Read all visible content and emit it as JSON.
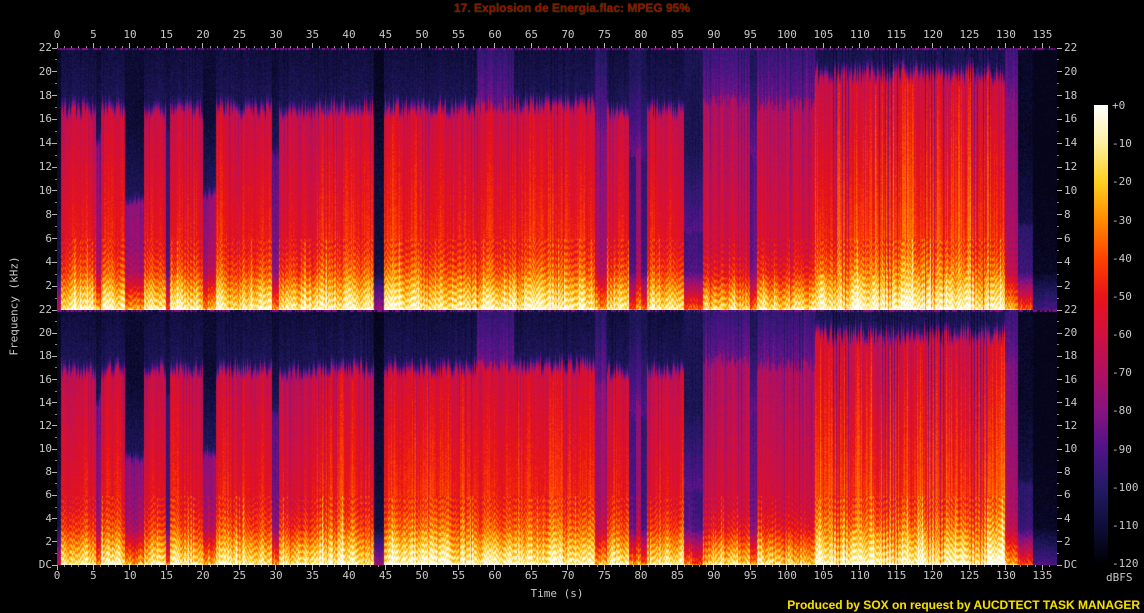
{
  "header": {
    "title": "17. Explosion de Energia.flac: MPEG 95%"
  },
  "footer": {
    "credit": "Produced by SOX on request by AUCDTECT TASK MANAGER"
  },
  "axes": {
    "time_label": "Time (s)",
    "freq_label": "Frequency (kHz)",
    "time_ticks": [
      "0",
      "5",
      "10",
      "15",
      "20",
      "25",
      "30",
      "35",
      "40",
      "45",
      "50",
      "55",
      "60",
      "65",
      "70",
      "75",
      "80",
      "85",
      "90",
      "95",
      "100",
      "105",
      "110",
      "115",
      "120",
      "125",
      "130",
      "135"
    ],
    "freq_ticks": [
      "22",
      "20",
      "18",
      "16",
      "14",
      "12",
      "10",
      "8",
      "6",
      "4",
      "2"
    ],
    "dc_label": "DC",
    "label_color": "#c8c8c8",
    "tick_color": "#b4b4b4"
  },
  "colorbar": {
    "labels": [
      "+0",
      "-10",
      "-20",
      "-30",
      "-40",
      "-50",
      "-60",
      "-70",
      "-80",
      "-90",
      "-100",
      "-110",
      "-120"
    ],
    "unit": "dBFS"
  },
  "colors": {
    "background": "#000000",
    "title_text": "#8b1200",
    "footer_text": "#e6e600"
  },
  "chart_data": {
    "type": "heatmap",
    "subtype": "stereo-audio-spectrogram",
    "title": "17. Explosion de Energia.flac: MPEG 95%",
    "xlabel": "Time (s)",
    "ylabel": "Frequency (kHz)",
    "colorbar_label": "dBFS",
    "x_range_s": [
      0,
      137
    ],
    "x_tick_step_s": 5,
    "y_range_khz": [
      0,
      22
    ],
    "y_tick_step_khz": 2,
    "colorbar_db_range": [
      0,
      -120
    ],
    "colorbar_db_step": -10,
    "channels": [
      "left",
      "right"
    ],
    "grid": false,
    "legend_position": "right-colorbar",
    "palette_stops": [
      [
        0.0,
        "#000006"
      ],
      [
        0.083,
        "#0f0e3a"
      ],
      [
        0.167,
        "#251a66"
      ],
      [
        0.25,
        "#4f1388"
      ],
      [
        0.333,
        "#871380"
      ],
      [
        0.417,
        "#b01060"
      ],
      [
        0.5,
        "#d01040"
      ],
      [
        0.583,
        "#e81418"
      ],
      [
        0.667,
        "#ff4400"
      ],
      [
        0.75,
        "#ff8c00"
      ],
      [
        0.833,
        "#ffd020"
      ],
      [
        0.917,
        "#fff0a0"
      ],
      [
        1.0,
        "#ffffff"
      ]
    ],
    "beat_period_s": 0.42,
    "sections": [
      {
        "t0": 0.0,
        "t1": 0.5,
        "level": 0.15,
        "cutoff_khz": 8.0,
        "haze": 0,
        "stripe": 0.0
      },
      {
        "t0": 0.5,
        "t1": 5.3,
        "level": 0.78,
        "cutoff_khz": 16.5,
        "haze": 0,
        "stripe": 0.3
      },
      {
        "t0": 5.3,
        "t1": 5.9,
        "level": 0.5,
        "cutoff_khz": 14.0,
        "haze": 0,
        "stripe": 0.3
      },
      {
        "t0": 5.9,
        "t1": 9.3,
        "level": 0.78,
        "cutoff_khz": 16.5,
        "haze": 0,
        "stripe": 0.3
      },
      {
        "t0": 9.3,
        "t1": 11.9,
        "level": 0.48,
        "cutoff_khz": 9.0,
        "haze": 0,
        "stripe": 0.25
      },
      {
        "t0": 11.9,
        "t1": 14.9,
        "level": 0.78,
        "cutoff_khz": 16.5,
        "haze": 0,
        "stripe": 0.3
      },
      {
        "t0": 14.9,
        "t1": 15.4,
        "level": 0.3,
        "cutoff_khz": 15.0,
        "haze": 0,
        "stripe": 0.3
      },
      {
        "t0": 15.4,
        "t1": 19.9,
        "level": 0.78,
        "cutoff_khz": 16.5,
        "haze": 0,
        "stripe": 0.35
      },
      {
        "t0": 19.9,
        "t1": 21.7,
        "level": 0.5,
        "cutoff_khz": 9.5,
        "haze": 0,
        "stripe": 0.25
      },
      {
        "t0": 21.7,
        "t1": 29.4,
        "level": 0.8,
        "cutoff_khz": 16.5,
        "haze": 0,
        "stripe": 0.35
      },
      {
        "t0": 29.4,
        "t1": 30.3,
        "level": 0.4,
        "cutoff_khz": 13.0,
        "haze": 0,
        "stripe": 0.3
      },
      {
        "t0": 30.3,
        "t1": 35.5,
        "level": 0.75,
        "cutoff_khz": 16.3,
        "haze": 0,
        "stripe": 0.4
      },
      {
        "t0": 35.5,
        "t1": 43.4,
        "level": 0.83,
        "cutoff_khz": 16.6,
        "haze": 0,
        "stripe": 0.45
      },
      {
        "t0": 43.4,
        "t1": 44.7,
        "level": 0.12,
        "cutoff_khz": 14.0,
        "haze": 0,
        "stripe": 0.0
      },
      {
        "t0": 44.7,
        "t1": 57.5,
        "level": 0.84,
        "cutoff_khz": 16.6,
        "haze": 0,
        "stripe": 0.45
      },
      {
        "t0": 57.5,
        "t1": 62.5,
        "level": 0.8,
        "cutoff_khz": 17.0,
        "haze": 1,
        "stripe": 0.4
      },
      {
        "t0": 62.5,
        "t1": 73.7,
        "level": 0.84,
        "cutoff_khz": 16.8,
        "haze": 0,
        "stripe": 0.45
      },
      {
        "t0": 73.7,
        "t1": 75.3,
        "level": 0.55,
        "cutoff_khz": 15.5,
        "haze": 1,
        "stripe": 0.3
      },
      {
        "t0": 75.3,
        "t1": 78.3,
        "level": 0.78,
        "cutoff_khz": 16.4,
        "haze": 0,
        "stripe": 0.4
      },
      {
        "t0": 78.3,
        "t1": 79.2,
        "level": 0.32,
        "cutoff_khz": 13.0,
        "haze": 1,
        "stripe": 0.2
      },
      {
        "t0": 79.2,
        "t1": 79.9,
        "level": 0.55,
        "cutoff_khz": 14.0,
        "haze": 1,
        "stripe": 0.2
      },
      {
        "t0": 79.9,
        "t1": 80.7,
        "level": 0.28,
        "cutoff_khz": 13.0,
        "haze": 1,
        "stripe": 0.2
      },
      {
        "t0": 80.7,
        "t1": 85.8,
        "level": 0.78,
        "cutoff_khz": 16.5,
        "haze": 0,
        "stripe": 0.4
      },
      {
        "t0": 85.8,
        "t1": 88.4,
        "level": 0.3,
        "cutoff_khz": 6.5,
        "haze": 1,
        "stripe": 0.15
      },
      {
        "t0": 88.4,
        "t1": 94.9,
        "level": 0.68,
        "cutoff_khz": 17.5,
        "haze": 1,
        "stripe": 0.45
      },
      {
        "t0": 94.9,
        "t1": 95.9,
        "level": 0.38,
        "cutoff_khz": 13.0,
        "haze": 1,
        "stripe": 0.3
      },
      {
        "t0": 95.9,
        "t1": 103.8,
        "level": 0.7,
        "cutoff_khz": 17.2,
        "haze": 1,
        "stripe": 0.5
      },
      {
        "t0": 103.8,
        "t1": 129.8,
        "level": 0.88,
        "cutoff_khz": 19.5,
        "haze": 0,
        "stripe": 0.75
      },
      {
        "t0": 129.8,
        "t1": 131.6,
        "level": 0.55,
        "cutoff_khz": 18.0,
        "haze": 1,
        "stripe": 0.4
      },
      {
        "t0": 131.6,
        "t1": 133.6,
        "level": 0.25,
        "cutoff_khz": 7.0,
        "haze": 0,
        "stripe": 0.1
      },
      {
        "t0": 133.6,
        "t1": 137.0,
        "level": 0.07,
        "cutoff_khz": 3.0,
        "haze": 0,
        "stripe": 0.0
      }
    ]
  }
}
